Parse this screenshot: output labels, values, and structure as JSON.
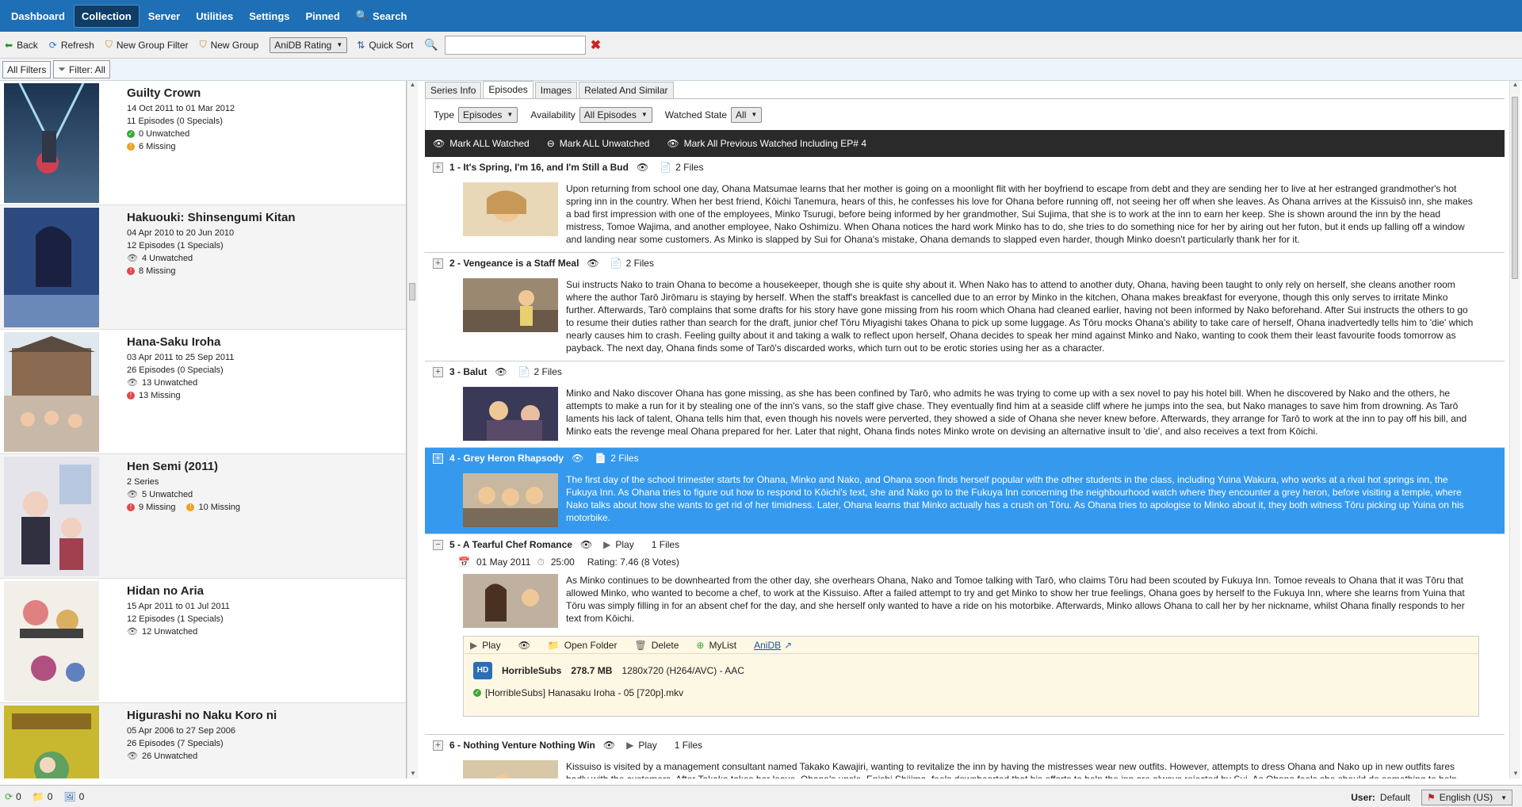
{
  "nav": {
    "items": [
      "Dashboard",
      "Collection",
      "Server",
      "Utilities",
      "Settings",
      "Pinned",
      "Search"
    ],
    "active": "Collection"
  },
  "toolbar": {
    "back": "Back",
    "refresh": "Refresh",
    "new_group_filter": "New Group Filter",
    "new_group": "New Group",
    "sort_select": "AniDB Rating",
    "quick_sort": "Quick Sort",
    "search_value": ""
  },
  "filters": {
    "all_filters": "All Filters",
    "filter": "Filter: All"
  },
  "series": [
    {
      "name": "Guilty Crown",
      "dates": "14 Oct 2011  to  01 Mar 2012",
      "episodes": "11 Episodes (0 Specials)",
      "s1": "0  Unwatched",
      "s2": "6  Missing"
    },
    {
      "name": "Hakuouki: Shinsengumi Kitan",
      "dates": "04 Apr 2010  to  20 Jun 2010",
      "episodes": "12 Episodes (1 Specials)",
      "s1": "4  Unwatched",
      "s2": "8  Missing"
    },
    {
      "name": "Hana-Saku Iroha",
      "dates": "03 Apr 2011  to  25 Sep 2011",
      "episodes": "26 Episodes (0 Specials)",
      "s1": "13  Unwatched",
      "s2": "13  Missing"
    },
    {
      "name": "Hen Semi (2011)",
      "dates": "",
      "episodes": "2 Series",
      "s1": "5  Unwatched",
      "s2": "9  Missing",
      "s3": "10  Missing"
    },
    {
      "name": "Hidan no Aria",
      "dates": "15 Apr 2011  to  01 Jul 2011",
      "episodes": "12 Episodes (1 Specials)",
      "s1": "12  Unwatched",
      "s2": ""
    },
    {
      "name": "Higurashi no Naku Koro ni",
      "dates": "05 Apr 2006  to  27 Sep 2006",
      "episodes": "26 Episodes (7 Specials)",
      "s1": "26  Unwatched",
      "s2": ""
    }
  ],
  "tabs": [
    "Series Info",
    "Episodes",
    "Images",
    "Related And Similar"
  ],
  "ep_filters": {
    "type_label": "Type",
    "type_value": "Episodes",
    "avail_label": "Availability",
    "avail_value": "All Episodes",
    "watched_label": "Watched State",
    "watched_value": "All"
  },
  "mark": {
    "all_watched": "Mark ALL Watched",
    "all_unwatched": "Mark ALL Unwatched",
    "prev_watched": "Mark All Previous Watched Including EP# 4"
  },
  "episodes": [
    {
      "title": "1 - It's Spring, I'm 16, and I'm Still a Bud",
      "files": "2 Files",
      "desc": "Upon returning from school one day, Ohana Matsumae learns that her mother is going on a moonlight flit with her boyfriend to escape from debt and they are sending her to live at her estranged grandmother's hot spring inn in the country. When her best friend, Kōichi Tanemura, hears of this, he confesses his love for Ohana before running off, not seeing her off when she leaves. As Ohana arrives at the Kissuisō inn, she makes a bad first impression with one of the employees, Minko Tsurugi, before being informed by her grandmother, Sui Sujima, that she is to work at the inn to earn her keep. She is shown around the inn by the head mistress, Tomoe Wajima, and another employee, Nako Oshimizu. When Ohana notices the hard work Minko has to do, she tries to do something nice for her by airing out her futon, but it ends up falling off a window and landing near some customers. As Minko is slapped by Sui for Ohana's mistake, Ohana demands to slapped even harder, though Minko doesn't particularly thank her for it."
    },
    {
      "title": "2 - Vengeance is a Staff Meal",
      "files": "2 Files",
      "desc": "Sui instructs Nako to train Ohana to become a housekeeper, though she is quite shy about it. When Nako has to attend to another duty, Ohana, having been taught to only rely on herself, she cleans another room where the author Tarō Jirōmaru is staying by herself. When the staff's breakfast is cancelled due to an error by Minko in the kitchen, Ohana makes breakfast for everyone, though this only serves to irritate Minko further. Afterwards, Tarō complains that some drafts for his story have gone missing from his room which Ohana had cleaned earlier, having not been informed by Nako beforehand. After Sui instructs the others to go to resume their duties rather than search for the draft, junior chef Tōru Miyagishi takes Ohana to pick up some luggage. As Tōru mocks Ohana's ability to take care of herself, Ohana inadvertedly tells him to 'die' which nearly causes him to crash. Feeling guilty about it and taking a walk to reflect upon herself, Ohana decides to speak her mind against Minko and Nako, wanting to cook them their least favourite foods tomorrow as payback. The next day, Ohana finds some of Tarō's discarded works, which turn out to be erotic stories using her as a character."
    },
    {
      "title": "3 - Balut",
      "files": "2 Files",
      "desc": "Minko and Nako discover Ohana has gone missing, as she has been confined by Tarō, who admits he was trying to come up with a sex novel to pay his hotel bill. When he discovered by Nako and the others, he attempts to make a run for it by stealing one of the inn's vans, so the staff give chase. They eventually find him at a seaside cliff where he jumps into the sea, but Nako manages to save him from drowning. As Tarō laments his lack of talent, Ohana tells him that, even though his novels were perverted, they showed a side of Ohana she never knew before. Afterwards, they arrange for Tarō to work at the inn to pay off his bill, and Minko eats the revenge meal Ohana prepared for her. Later that night, Ohana finds notes Minko wrote on devising an alternative insult to 'die', and also receives a text from Kōichi."
    },
    {
      "title": "4 - Grey Heron Rhapsody",
      "files": "2 Files",
      "desc": "The first day of the school trimester starts for Ohana, Minko and Nako, and Ohana soon finds herself popular with the other students in the class, including Yuina Wakura, who works at a rival hot springs inn, the Fukuya Inn. As Ohana tries to figure out how to respond to Kōichi's text, she and Nako go to the Fukuya Inn concerning the neighbourhood watch where they encounter a grey heron, before visiting a temple, where Nako talks about how she wants to get rid of her timidness. Later, Ohana learns that Minko actually has a crush on Tōru. As Ohana tries to apologise to Minko about it, they both witness Tōru picking up Yuina on his motorbike."
    },
    {
      "title": "5 - A Tearful Chef Romance",
      "play": "Play",
      "files": "1 Files",
      "date": "01 May 2011",
      "duration": "25:00",
      "rating": "Rating: 7.46 (8 Votes)",
      "desc": "As Minko continues to be downhearted from the other day, she overhears Ohana, Nako and Tomoe talking with Tarō, who claims Tōru had been scouted by Fukuya Inn. Tomoe reveals to Ohana that it was Tōru that allowed Minko, who wanted to become a chef, to work at the Kissuiso. After a failed attempt to try and get Minko to show her true feelings, Ohana goes by herself to the Fukuya Inn, where she learns from Yuina that Tōru was simply filling in for an absent chef for the day, and she herself only wanted to have a ride on his motorbike. Afterwards, Minko allows Ohana to call her by her nickname, whilst Ohana finally responds to her text from Kōichi."
    },
    {
      "title": "6 - Nothing Venture Nothing Win",
      "play": "Play",
      "files": "1 Files",
      "desc": "Kissuiso is visited by a management consultant named Takako Kawajiri, wanting to revitalize the inn by having the mistresses wear new outfits. However, attempts to dress Ohana and Nako up in new outfits fares badly with the customers. After Takako takes her leave, Ohana's uncle, Enishi Shijima, feels downhearted that his efforts to help the inn are always rejected by Sui. As Ohana feels she should do something to help improve"
    }
  ],
  "file": {
    "play": "Play",
    "open_folder": "Open Folder",
    "delete": "Delete",
    "mylist": "MyList",
    "anidb": "AniDB",
    "hd": "HD",
    "group": "HorribleSubs",
    "size": "278.7 MB",
    "video": "1280x720 (H264/AVC) - AAC",
    "filename": "[HorribleSubs] Hanasaku Iroha - 05 [720p].mkv"
  },
  "status": {
    "a": "0",
    "b": "0",
    "c": "0",
    "user_label": "User:",
    "user": "Default",
    "lang": "English (US)"
  },
  "colors": {
    "nav": "#1e6fb5",
    "selected": "#3599ee",
    "green": "#3aa83a",
    "orange": "#f0a020",
    "red": "#e04848"
  }
}
